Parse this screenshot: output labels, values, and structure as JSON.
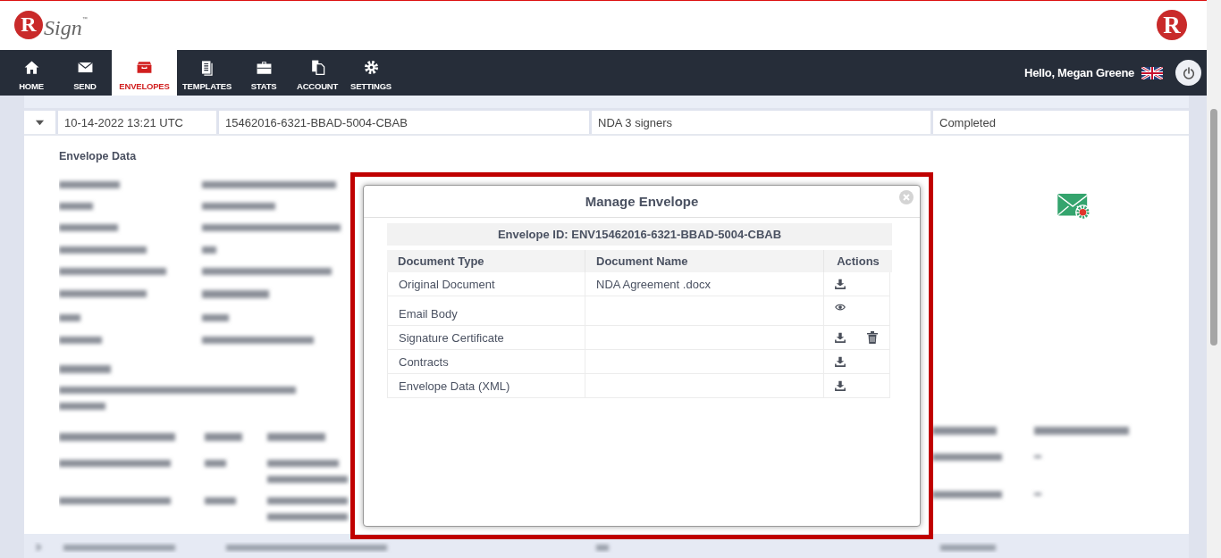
{
  "header": {
    "logo": {
      "initial": "R",
      "name": "Sign",
      "mark": "™"
    },
    "corner_logo": "R"
  },
  "nav": {
    "items": [
      {
        "label": "HOME",
        "kind": "home",
        "selected": false
      },
      {
        "label": "SEND",
        "kind": "send",
        "selected": false
      },
      {
        "label": "ENVELOPES",
        "kind": "envelopes",
        "selected": true
      },
      {
        "label": "TEMPLATES",
        "kind": "templates",
        "selected": false
      },
      {
        "label": "STATS",
        "kind": "stats",
        "selected": false
      },
      {
        "label": "ACCOUNT",
        "kind": "account",
        "selected": false
      },
      {
        "label": "SETTINGS",
        "kind": "settings",
        "selected": false
      }
    ],
    "greeting": "Hello, Megan Greene"
  },
  "envelopes": [
    {
      "expanded": true,
      "date": "10-14-2022 13:21 UTC",
      "id": "15462016-6321-BBAD-5004-CBAB",
      "subject": "NDA 3 signers",
      "status": "Completed"
    }
  ],
  "details": {
    "title": "Envelope Data"
  },
  "modal": {
    "title": "Manage Envelope",
    "envelope_id": "Envelope ID: ENV15462016-6321-BBAD-5004-CBAB",
    "columns": [
      "Document Type",
      "Document Name",
      "Actions"
    ],
    "rows": [
      {
        "type": "Original Document",
        "name": "NDA Agreement .docx",
        "actions": [
          {
            "kind": "download"
          }
        ]
      },
      {
        "type": "Email Body",
        "actions": [
          {
            "kind": "view"
          }
        ]
      },
      {
        "type": "Signature Certificate",
        "actions": [
          {
            "kind": "download"
          },
          {
            "kind": "delete"
          }
        ]
      },
      {
        "type": "Contracts",
        "actions": [
          {
            "kind": "download"
          }
        ]
      },
      {
        "type": "Envelope Data (XML)",
        "actions": [
          {
            "kind": "download"
          }
        ]
      }
    ]
  }
}
